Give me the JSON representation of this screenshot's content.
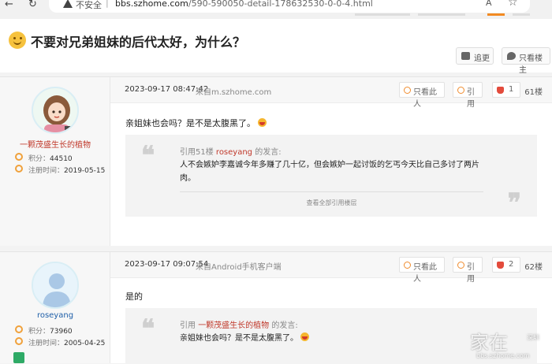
{
  "browser": {
    "security_label": "不安全",
    "url_host": "bbs.szhome.com",
    "url_path": "/590-590050-detail-178632530-0-0-4.html",
    "read_aloud": "A",
    "icons": [
      "back-icon",
      "reload-icon",
      "warning-icon",
      "read-aloud-icon",
      "star-icon"
    ]
  },
  "page": {
    "title": "不要对兄弟姐妹的后代太好，为什么？",
    "follow_label": "追更",
    "owner_only_label": "只看楼主"
  },
  "posts": [
    {
      "date": "2023-09-17 08:47:42",
      "from": "来自m.szhome.com",
      "only_this_label": "只看此人",
      "quote_label": "引用",
      "likes": "1",
      "floor": "61楼",
      "username": "一颗茂盛生长的植物",
      "points_label": "积分：",
      "points": "44510",
      "reg_label": "注册时间：",
      "reg_date": "2019-05-15",
      "content": "亲姐妹也会吗？是不是太腹黑了。",
      "quote": {
        "prefix": "引用51楼",
        "user": "roseyang",
        "suffix": "的发言:",
        "text": "人不会嫉妒李嘉诚今年多赚了几十亿，但会嫉妒一起讨饭的乞丐今天比自己多讨了两片肉。",
        "view_all": "查看全部引用楼层"
      }
    },
    {
      "date": "2023-09-17 09:07:54",
      "from": "来自Android手机客户端",
      "only_this_label": "只看此人",
      "quote_label": "引用",
      "likes": "2",
      "floor": "62楼",
      "username": "roseyang",
      "points_label": "积分：",
      "points": "73960",
      "reg_label": "注册时间：",
      "reg_date": "2005-04-25",
      "content": "是的",
      "quote": {
        "prefix": "引用",
        "user": "一颗茂盛生长的植物",
        "suffix": "的发言:",
        "text": "亲姐妹也会吗？是不是太腹黑了。"
      }
    }
  ],
  "watermark": {
    "big": "家在",
    "small": "深圳",
    "url": "bbs.szhome.com"
  },
  "colors": {
    "accent": "#f28a22",
    "username_red": "#c0392b",
    "username_blue": "#1f5fa8",
    "like_red": "#e34b3c"
  }
}
